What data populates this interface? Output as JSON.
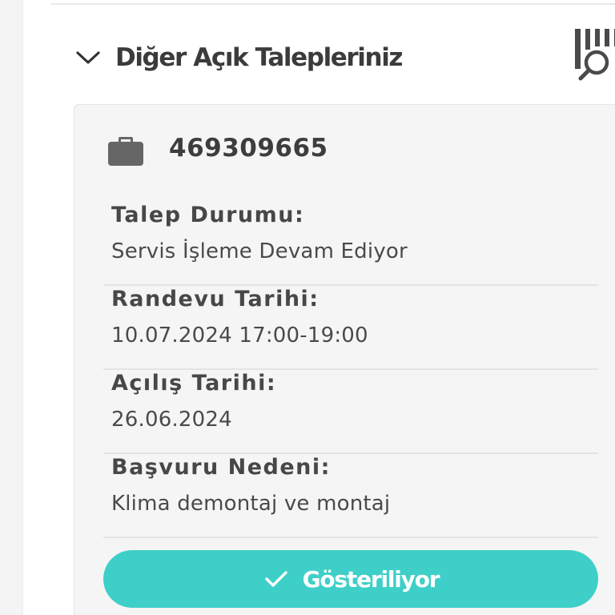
{
  "section": {
    "title": "Diğer Açık Talepleriniz",
    "collapse_icon": "chevron-down-icon",
    "action_icon": "search-list-icon"
  },
  "request": {
    "case_icon": "briefcase-icon",
    "case_number": "469309665",
    "fields": [
      {
        "label": "Talep Durumu:",
        "value": "Servis İşleme Devam Ediyor"
      },
      {
        "label": "Randevu Tarihi:",
        "value": "10.07.2024 17:00-19:00"
      },
      {
        "label": "Açılış Tarihi:",
        "value": "26.06.2024"
      },
      {
        "label": "Başvuru Nedeni:",
        "value": "Klima demontaj ve montaj"
      }
    ],
    "button_label": "Gösteriliyor",
    "button_icon": "check-icon"
  },
  "colors": {
    "accent": "#3ecfc8",
    "text_dark": "#3b3b3b",
    "card_background": "#f5f5f5"
  }
}
